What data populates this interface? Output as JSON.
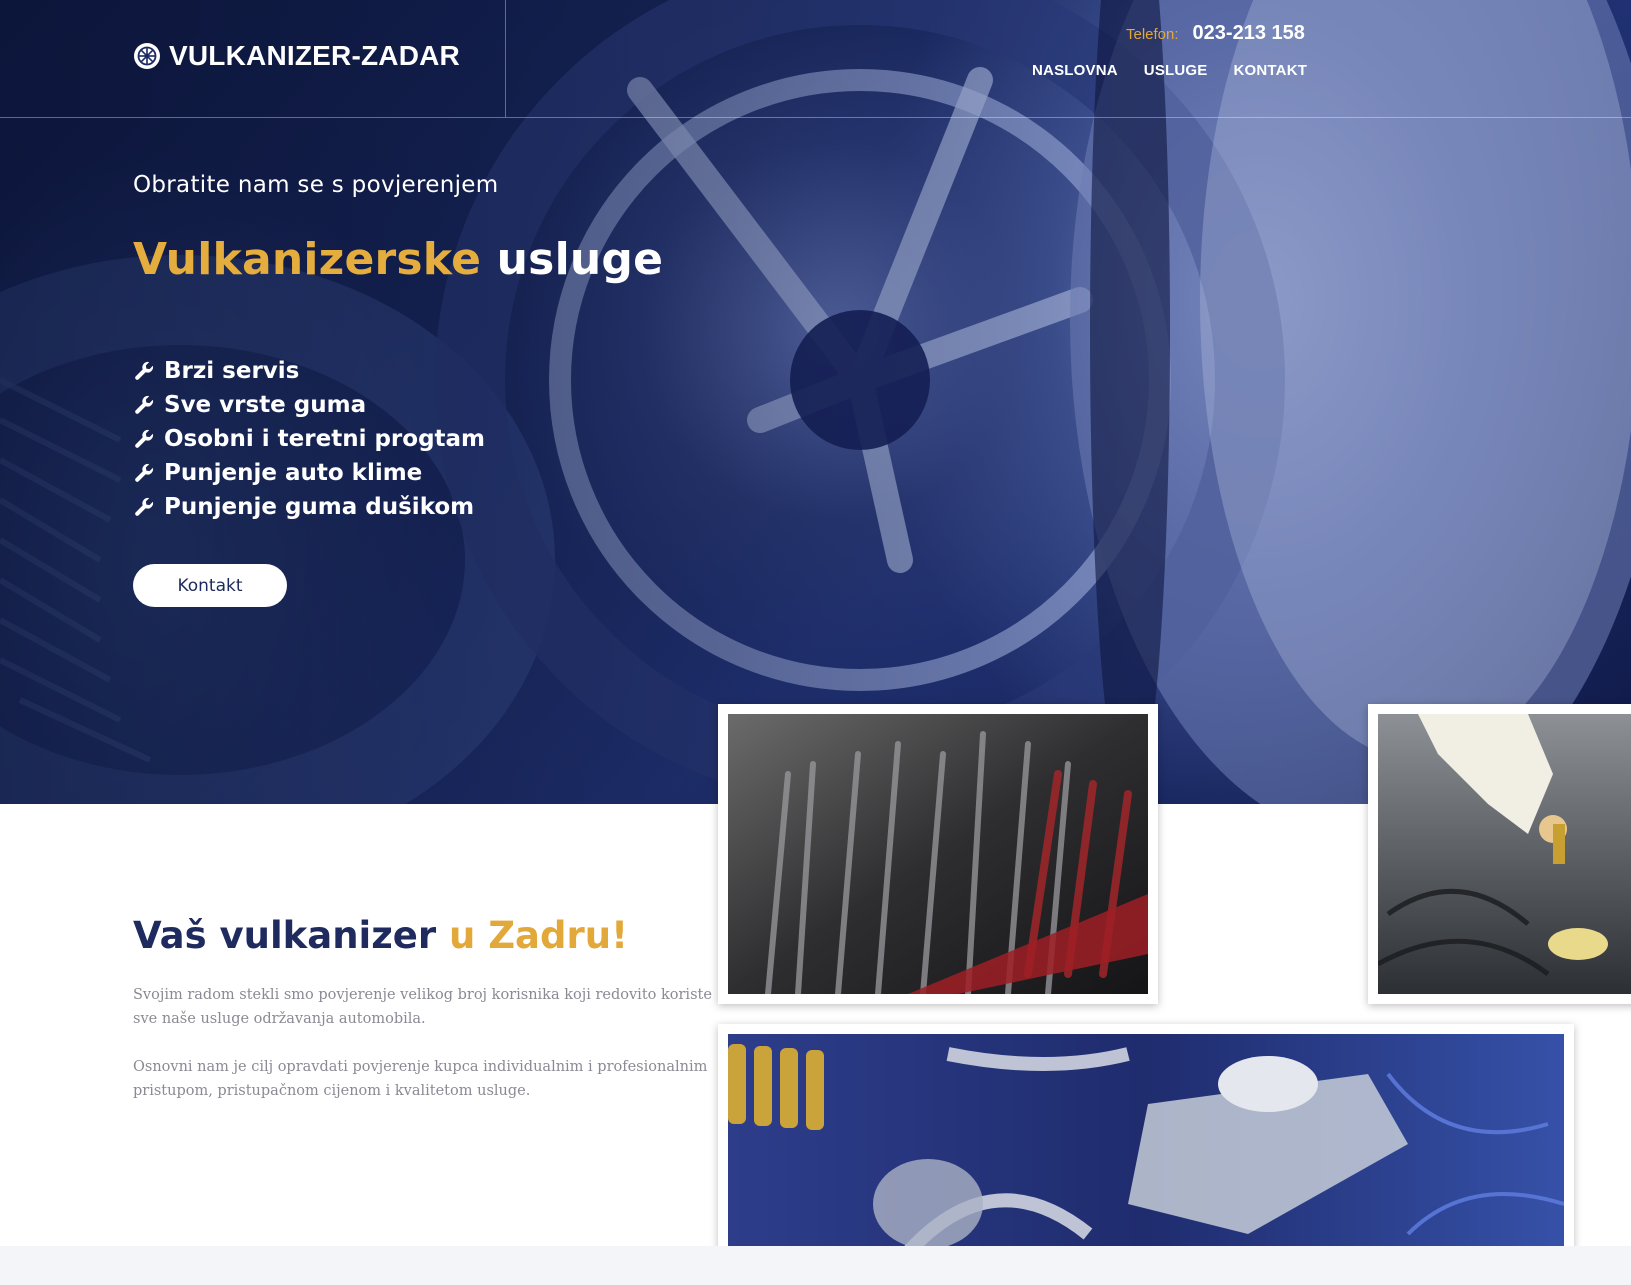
{
  "header": {
    "logo_text": "VULKANIZER-ZADAR",
    "phone_label": "Telefon:",
    "phone_number": "023-213 158",
    "nav": [
      {
        "label": "NASLOVNA"
      },
      {
        "label": "USLUGE"
      },
      {
        "label": "KONTAKT"
      }
    ]
  },
  "hero": {
    "subtitle": "Obratite nam se s povjerenjem",
    "title_accent": "Vulkanizerske",
    "title_rest": "usluge",
    "features": [
      "Brzi servis",
      "Sve vrste guma",
      "Osobni i teretni progtam",
      "Punjenje auto klime",
      "Punjenje guma dušikom"
    ],
    "button_label": "Kontakt"
  },
  "about": {
    "title_main": "Vaš vulkanizer",
    "title_accent": "u Zadru!",
    "paragraph1": "Svojim radom stekli smo povjerenje velikog broj korisnika koji redovito koriste sve naše usluge održavanja automobila.",
    "paragraph2": "Osnovni nam je cilj opravdati povjerenje kupca individualnim i profesionalnim pristupom, pristupačnom cijenom i kvalitetom usluge."
  },
  "colors": {
    "accent": "#e2a83a",
    "navy": "#1f2b5e",
    "hero_bg": "#1a2a63"
  },
  "icons": {
    "logo": "tire-icon",
    "feature": "wrench-icon"
  }
}
